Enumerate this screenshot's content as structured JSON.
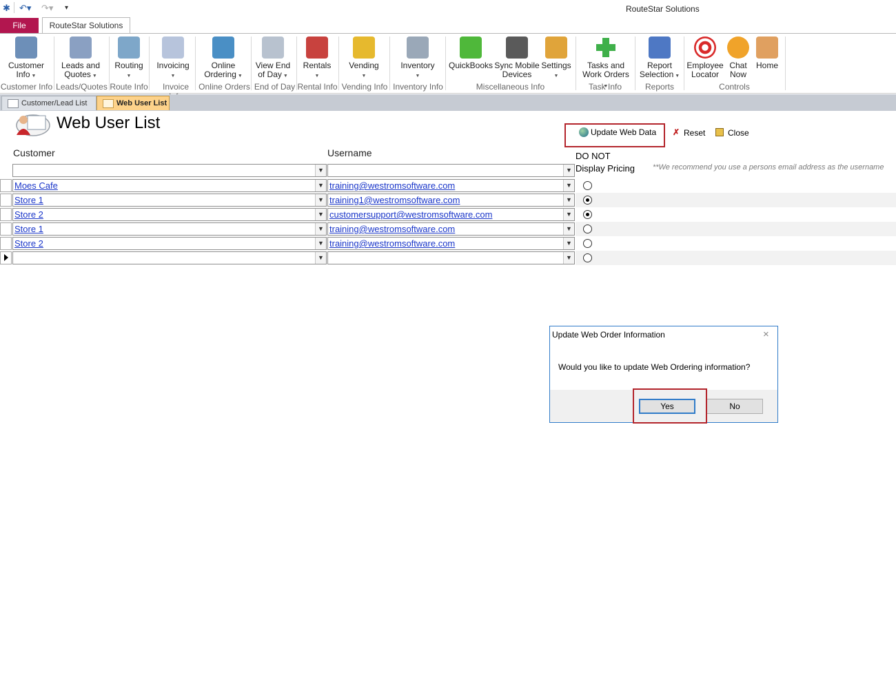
{
  "app_title": "RouteStar Solutions",
  "ribbon": {
    "file_label": "File",
    "tab_label": "RouteStar Solutions",
    "buttons": [
      {
        "l1": "Customer",
        "l2": "Info",
        "dd": true
      },
      {
        "l1": "Leads and",
        "l2": "Quotes",
        "dd": true
      },
      {
        "l1": "Routing",
        "l2": "",
        "dd": true
      },
      {
        "l1": "Invoicing",
        "l2": "",
        "dd": true
      },
      {
        "l1": "Online",
        "l2": "Ordering",
        "dd": true
      },
      {
        "l1": "View End",
        "l2": "of Day",
        "dd": true
      },
      {
        "l1": "Rentals",
        "l2": "",
        "dd": true
      },
      {
        "l1": "Vending",
        "l2": "",
        "dd": true
      },
      {
        "l1": "Inventory",
        "l2": "",
        "dd": true
      },
      {
        "l1": "QuickBooks",
        "l2": "",
        "dd": false
      },
      {
        "l1": "Sync Mobile",
        "l2": "Devices",
        "dd": false
      },
      {
        "l1": "Settings",
        "l2": "",
        "dd": true
      },
      {
        "l1": "Tasks and",
        "l2": "Work Orders",
        "dd": true
      },
      {
        "l1": "Report",
        "l2": "Selection",
        "dd": true
      },
      {
        "l1": "Employee",
        "l2": "Locator",
        "dd": false
      },
      {
        "l1": "Chat",
        "l2": "Now",
        "dd": false
      },
      {
        "l1": "Home",
        "l2": "",
        "dd": false
      }
    ],
    "groups": [
      "Customer Info",
      "Leads/Quotes",
      "Route Info",
      "Invoice Info",
      "Online Orders",
      "End of Day",
      "Rental Info",
      "Vending Info",
      "Inventory Info",
      "Miscellaneous Info",
      "Task Info",
      "Reports",
      "Controls"
    ]
  },
  "doc_tabs": [
    "Customer/Lead List",
    "Web User List"
  ],
  "form": {
    "title": "Web User List",
    "update_label": "Update Web Data",
    "reset_label": "Reset",
    "close_label": "Close",
    "col_customer": "Customer",
    "col_username": "Username",
    "col_pricing_1": "DO NOT",
    "col_pricing_2": "Display Pricing",
    "note": "**We recommend you use a persons email address as the username",
    "rows": [
      {
        "customer": "Moes Cafe",
        "username": "training@westromsoftware.com",
        "no_pricing": false
      },
      {
        "customer": "Store 1",
        "username": "training1@westromsoftware.com",
        "no_pricing": true
      },
      {
        "customer": "Store 2",
        "username": "customersupport@westromsoftware.com",
        "no_pricing": true
      },
      {
        "customer": "Store 1",
        "username": "training@westromsoftware.com",
        "no_pricing": false
      },
      {
        "customer": "Store 2",
        "username": "training@westromsoftware.com",
        "no_pricing": false
      }
    ]
  },
  "dialog": {
    "title": "Update Web Order Information",
    "message": "Would you like to update Web Ordering information?",
    "yes_label": "Yes",
    "no_label": "No"
  },
  "colors": {
    "file_tab": "#b2164f",
    "active_doc_tab": "#fdd28a",
    "highlight": "#b3242b",
    "link": "#1a36c9"
  }
}
